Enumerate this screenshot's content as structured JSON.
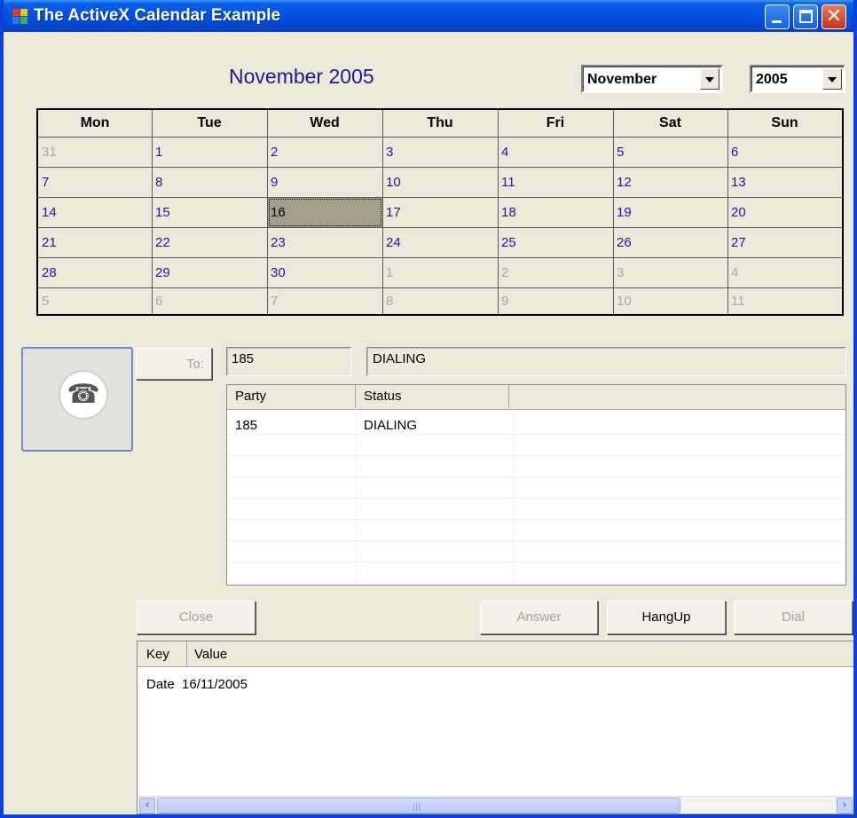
{
  "window": {
    "title": "The ActiveX Calendar Example",
    "close_glyph": "✕"
  },
  "calendar": {
    "month_header": "November 2005",
    "month_combo": "November",
    "year_combo": "2005",
    "weekdays": [
      "Mon",
      "Tue",
      "Wed",
      "Thu",
      "Fri",
      "Sat",
      "Sun"
    ],
    "weeks": [
      [
        "31",
        "1",
        "2",
        "3",
        "4",
        "5",
        "6"
      ],
      [
        "7",
        "8",
        "9",
        "10",
        "11",
        "12",
        "13"
      ],
      [
        "14",
        "15",
        "16",
        "17",
        "18",
        "19",
        "20"
      ],
      [
        "21",
        "22",
        "23",
        "24",
        "25",
        "26",
        "27"
      ],
      [
        "28",
        "29",
        "30",
        "1",
        "2",
        "3",
        "4"
      ],
      [
        "5",
        "6",
        "7",
        "8",
        "9",
        "10",
        "11"
      ]
    ],
    "out_of_month": [
      [
        0,
        0
      ],
      [
        4,
        3
      ],
      [
        4,
        4
      ],
      [
        4,
        5
      ],
      [
        4,
        6
      ],
      [
        5,
        0
      ],
      [
        5,
        1
      ],
      [
        5,
        2
      ],
      [
        5,
        3
      ],
      [
        5,
        4
      ],
      [
        5,
        5
      ],
      [
        5,
        6
      ]
    ],
    "selected": [
      2,
      2
    ]
  },
  "phone": {
    "icon": "phone-icon",
    "glyph": "☎",
    "to_label": "To:",
    "number": "185",
    "status": "DIALING"
  },
  "calls": {
    "columns": [
      "Party",
      "Status"
    ],
    "rows": [
      {
        "party": "185",
        "status": "DIALING"
      }
    ]
  },
  "buttons": {
    "close": "Close",
    "answer": "Answer",
    "hangup": "HangUp",
    "dial": "Dial"
  },
  "properties": {
    "columns": [
      "Key",
      "Value"
    ],
    "rows": [
      {
        "key": "Date",
        "value": "16/11/2005"
      }
    ]
  },
  "scrollbar": {
    "left_glyph": "‹",
    "right_glyph": "›",
    "grip": "|||"
  },
  "colors": {
    "titlebar": "#0055e5",
    "month_header": "#1a1a96",
    "day_text": "#1a1aa0",
    "other_month_text": "#a8a8a8",
    "selected_cell": "#a49e8c"
  }
}
